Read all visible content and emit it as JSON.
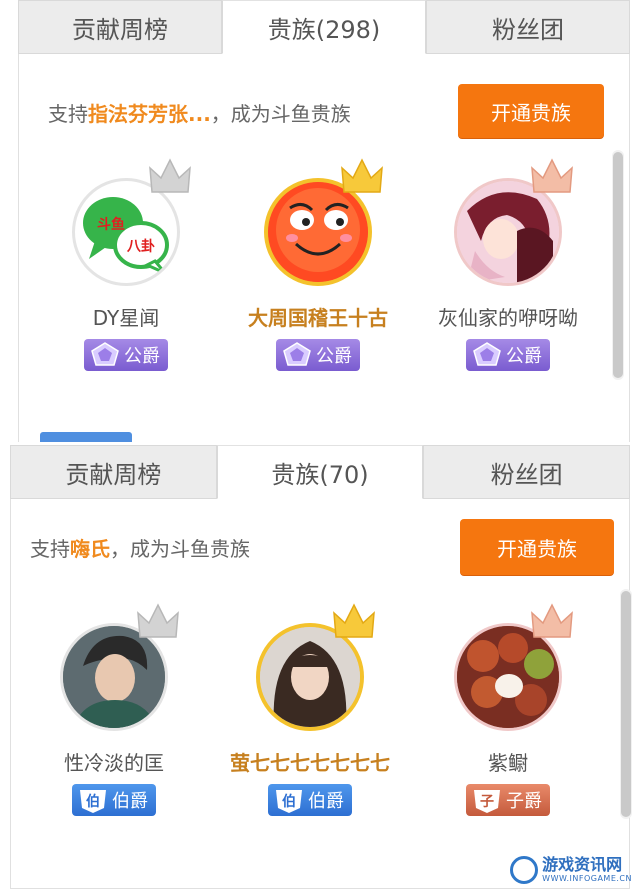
{
  "panel1": {
    "tabs": [
      "贡献周榜",
      "贵族(298)",
      "粉丝团"
    ],
    "support_prefix": "支持",
    "support_name": "指法芬芳张...",
    "support_suffix": "，成为斗鱼贵族",
    "open_button": "开通贵族",
    "users": [
      {
        "name": "DY星闻",
        "badge": "公爵",
        "crown": "silver",
        "avatar_text_1": "斗鱼",
        "avatar_text_2": "八卦"
      },
      {
        "name": "大周国稽王十古",
        "badge": "公爵",
        "crown": "gold"
      },
      {
        "name": "灰仙家的咿呀呦",
        "badge": "公爵",
        "crown": "pink"
      }
    ]
  },
  "panel2": {
    "tabs": [
      "贡献周榜",
      "贵族(70)",
      "粉丝团"
    ],
    "support_prefix": "支持",
    "support_name": "嗨氏",
    "support_suffix": "，成为斗鱼贵族",
    "open_button": "开通贵族",
    "users": [
      {
        "name": "性冷淡的匡",
        "badge": "伯爵",
        "badge_char": "伯",
        "crown": "silver"
      },
      {
        "name": "萤七七七七七七七",
        "badge": "伯爵",
        "badge_char": "伯",
        "crown": "gold"
      },
      {
        "name": "紫鳚",
        "badge": "子爵",
        "badge_char": "子",
        "crown": "pink"
      }
    ]
  },
  "watermark": {
    "cn": "游戏资讯网",
    "en": "WWW.INFOGAME.CN"
  },
  "colors": {
    "accent": "#f5760f",
    "highlight": "#f08a1e",
    "gold_name": "#c7801f",
    "duke": "#8a6ad8",
    "earl": "#3b7fdc",
    "viscount": "#d56a4a"
  }
}
